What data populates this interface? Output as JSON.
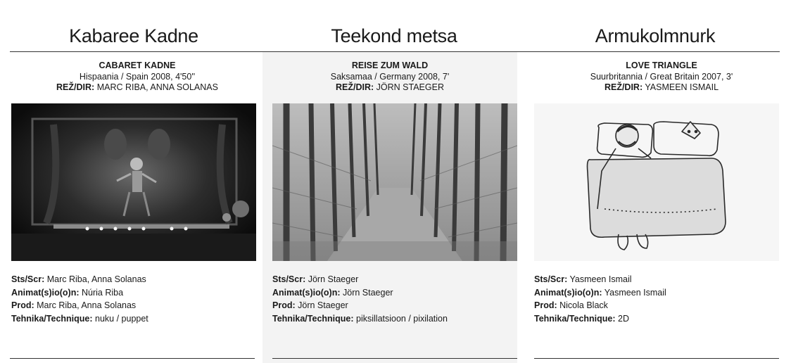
{
  "films": [
    {
      "title": "Kabaree Kadne",
      "original_title": "CABARET KADNE",
      "country_year": "Hispaania / Spain 2008, 4'50''",
      "director_label": "REŽ/DIR:",
      "director": "MARC RIBA, ANNA SOLANAS",
      "still_icon": "puppet-cabaret-stage-image",
      "credits": [
        {
          "label": "Sts/Scr:",
          "value": "Marc Riba, Anna Solanas"
        },
        {
          "label": "Animat(s)io(o)n:",
          "value": "Núria Riba"
        },
        {
          "label": "Prod:",
          "value": "Marc Riba, Anna Solanas"
        },
        {
          "label": "Tehnika/Technique:",
          "value": "nuku / puppet"
        }
      ]
    },
    {
      "title": "Teekond metsa",
      "original_title": "REISE ZUM WALD",
      "country_year": "Saksamaa / Germany 2008, 7'",
      "director_label": "REŽ/DIR:",
      "director": "JÖRN STAEGER",
      "still_icon": "forest-path-image",
      "credits": [
        {
          "label": "Sts/Scr:",
          "value": "Jörn Staeger"
        },
        {
          "label": "Animat(s)io(o)n:",
          "value": "Jörn Staeger"
        },
        {
          "label": "Prod:",
          "value": "Jörn Staeger"
        },
        {
          "label": "Tehnika/Technique:",
          "value": "piksillatsioon / pixilation"
        }
      ]
    },
    {
      "title": "Armukolmnurk",
      "original_title": "LOVE TRIANGLE",
      "country_year": "Suurbritannia / Great Britain 2007, 3'",
      "director_label": "REŽ/DIR:",
      "director": "YASMEEN ISMAIL",
      "still_icon": "bed-drawing-image",
      "credits": [
        {
          "label": "Sts/Scr:",
          "value": "Yasmeen Ismail"
        },
        {
          "label": "Animat(s)io(o)n:",
          "value": "Yasmeen Ismail"
        },
        {
          "label": "Prod:",
          "value": "Nicola Black"
        },
        {
          "label": "Tehnika/Technique:",
          "value": "2D"
        }
      ]
    }
  ]
}
